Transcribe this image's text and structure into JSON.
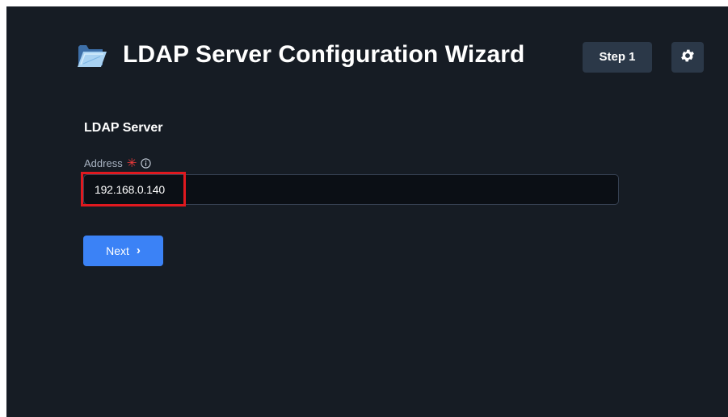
{
  "header": {
    "title": "LDAP Server Configuration Wizard",
    "step_label": "Step 1",
    "logo_icon": "folder-icon",
    "settings_icon": "gear-icon"
  },
  "section": {
    "title": "LDAP Server"
  },
  "address_field": {
    "label": "Address",
    "required_mark": "✳",
    "info_icon": "info-icon",
    "value": "192.168.0.140",
    "highlighted": true
  },
  "actions": {
    "next_label": "Next",
    "next_icon": "›"
  },
  "colors": {
    "background": "#161c24",
    "accent": "#3b82f6",
    "badge": "#2b3848",
    "required": "#ef3b3b",
    "highlight": "#e0191f"
  }
}
